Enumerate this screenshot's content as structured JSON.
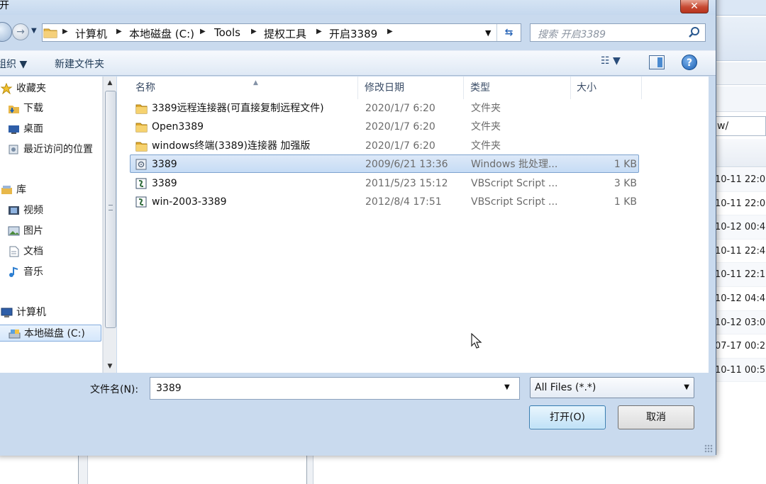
{
  "background": {
    "address_text": "w/",
    "timestamps": [
      "10-11 22:0",
      "10-11 22:0",
      "10-12 00:4",
      "10-11 22:4",
      "10-11 22:1",
      "10-12 04:4",
      "10-12 03:0",
      "07-17 00:2",
      "10-11 00:5"
    ]
  },
  "dialog": {
    "title": "开",
    "close_label": "✕"
  },
  "nav": {
    "breadcrumbs": [
      "计算机",
      "本地磁盘 (C:)",
      "Tools",
      "提权工具",
      "开启3389"
    ],
    "search_placeholder": "搜索 开启3389"
  },
  "toolbar": {
    "organize_label": "组织 ▼",
    "new_folder_label": "新建文件夹",
    "help_label": "?"
  },
  "navpane": {
    "items": [
      {
        "label": "收藏夹",
        "icon": "star-icon"
      },
      {
        "label": "下载",
        "icon": "download-folder-icon"
      },
      {
        "label": "桌面",
        "icon": "desktop-icon"
      },
      {
        "label": "最近访问的位置",
        "icon": "recent-places-icon"
      },
      {
        "label": "库",
        "icon": "library-icon"
      },
      {
        "label": "视频",
        "icon": "video-icon"
      },
      {
        "label": "图片",
        "icon": "picture-icon"
      },
      {
        "label": "文档",
        "icon": "document-icon"
      },
      {
        "label": "音乐",
        "icon": "music-icon"
      },
      {
        "label": "计算机",
        "icon": "computer-icon"
      },
      {
        "label": "本地磁盘 (C:)",
        "icon": "drive-icon"
      }
    ],
    "selected_index": 10
  },
  "filelist": {
    "columns": [
      "名称",
      "修改日期",
      "类型",
      "大小"
    ],
    "rows": [
      {
        "name": "3389远程连接器(可直接复制远程文件)",
        "date": "2020/1/7 6:20",
        "type": "文件夹",
        "size": "",
        "icon": "folder-icon"
      },
      {
        "name": "Open3389",
        "date": "2020/1/7 6:20",
        "type": "文件夹",
        "size": "",
        "icon": "folder-icon"
      },
      {
        "name": "windows终端(3389)连接器 加强版",
        "date": "2020/1/7 6:20",
        "type": "文件夹",
        "size": "",
        "icon": "folder-icon"
      },
      {
        "name": "3389",
        "date": "2009/6/21 13:36",
        "type": "Windows 批处理...",
        "size": "1 KB",
        "icon": "batch-file-icon"
      },
      {
        "name": "3389",
        "date": "2011/5/23 15:12",
        "type": "VBScript Script ...",
        "size": "3 KB",
        "icon": "vbscript-file-icon"
      },
      {
        "name": "win-2003-3389",
        "date": "2012/8/4 17:51",
        "type": "VBScript Script ...",
        "size": "1 KB",
        "icon": "vbscript-file-icon"
      }
    ],
    "selected_index": 3
  },
  "footer": {
    "filename_label": "文件名(N):",
    "filename_value": "3389",
    "filter_value": "All Files (*.*)",
    "open_label": "打开(O)",
    "cancel_label": "取消"
  }
}
